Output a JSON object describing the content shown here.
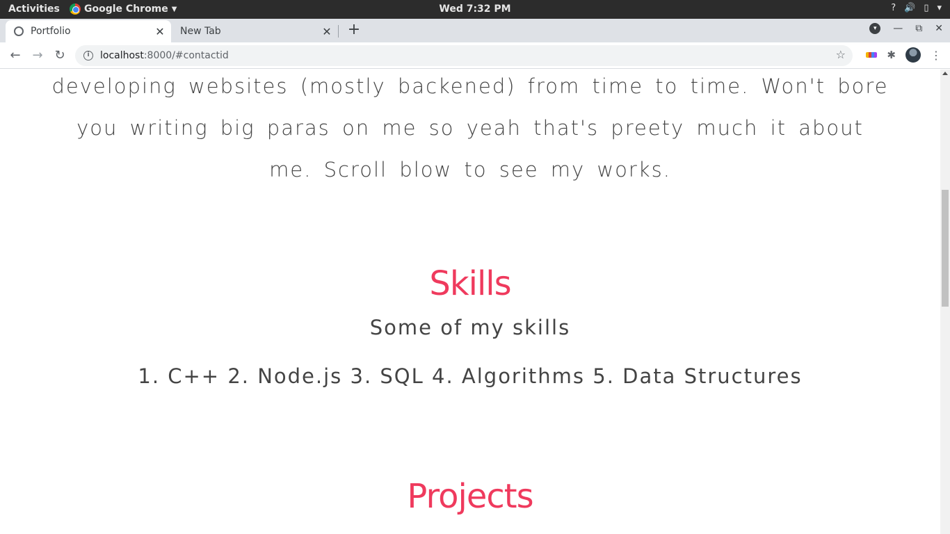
{
  "topbar": {
    "activities": "Activities",
    "app_name": "Google Chrome",
    "clock": "Wed  7:32 PM"
  },
  "tabs": [
    {
      "label": "Portfolio",
      "active": true
    },
    {
      "label": "New Tab",
      "active": false
    }
  ],
  "toolbar": {
    "url_host": "localhost",
    "url_rest": ":8000/#contactid"
  },
  "page": {
    "about_lines": [
      "developing websites (mostly backened) from time to time. Won't bore",
      "you writing big paras on me so yeah that's preety much it about",
      "me. Scroll blow to see my works."
    ],
    "skills_title": "Skills",
    "skills_subtitle": "Some of my skills",
    "skills_list": "1. C++ 2. Node.js 3. SQL 4. Algorithms 5. Data Structures",
    "projects_title": "Projects"
  },
  "colors": {
    "accent": "#ef3a5d",
    "text": "#444444"
  }
}
